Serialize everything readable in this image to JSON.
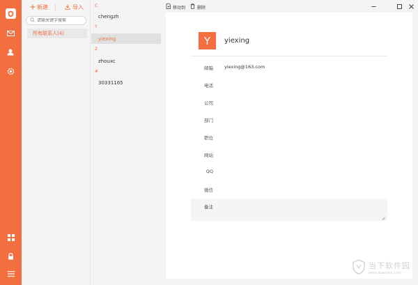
{
  "colors": {
    "accent": "#f36f3f",
    "rail": "#f36f3f"
  },
  "rail": {
    "icons": [
      "shield-logo-icon",
      "mail-icon",
      "contacts-icon",
      "settings-icon",
      "apps-icon",
      "lock-icon",
      "menu-icon"
    ]
  },
  "groups": {
    "new_label": "新建",
    "import_label": "导入",
    "search_placeholder": "请输关键字搜索",
    "items": [
      {
        "label": "所有联系人(4)"
      }
    ]
  },
  "contacts": {
    "sections": [
      {
        "letter": "C",
        "items": [
          "chengzh"
        ]
      },
      {
        "letter": "Y",
        "items": [
          "yiexing"
        ]
      },
      {
        "letter": "Z",
        "items": [
          "zhouxc"
        ]
      },
      {
        "letter": "#",
        "items": [
          "30331165"
        ]
      }
    ],
    "selected": "yiexing"
  },
  "toolbar": {
    "move_label": "移动到",
    "delete_label": "删除"
  },
  "detail": {
    "avatar_letter": "Y",
    "name": "yiexing",
    "fields": [
      {
        "label": "邮箱",
        "value": "yiexing@163.com"
      },
      {
        "label": "电话",
        "value": ""
      },
      {
        "label": "公司",
        "value": ""
      },
      {
        "label": "部门",
        "value": ""
      },
      {
        "label": "职位",
        "value": ""
      },
      {
        "label": "网站",
        "value": ""
      },
      {
        "label": "QQ",
        "value": ""
      },
      {
        "label": "微信",
        "value": ""
      }
    ],
    "notes_label": "备注"
  },
  "watermark": {
    "title": "当下软件园",
    "url": "www.downxia.com"
  }
}
